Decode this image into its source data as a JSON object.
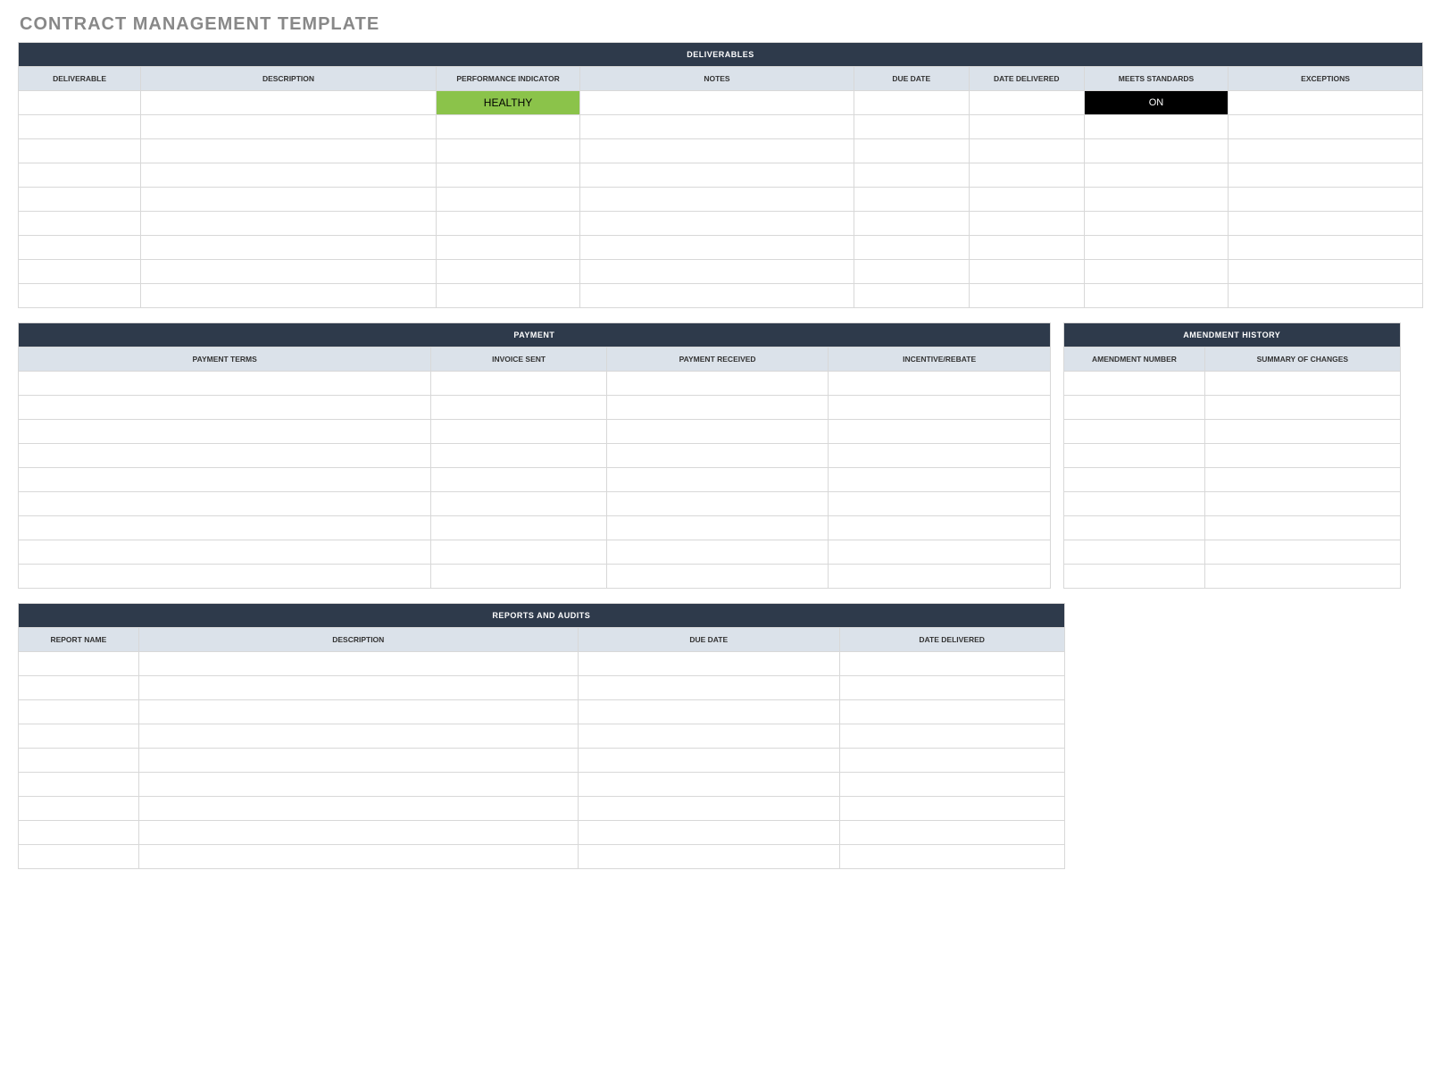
{
  "title": "CONTRACT MANAGEMENT TEMPLATE",
  "deliverables": {
    "section": "DELIVERABLES",
    "cols": [
      "DELIVERABLE",
      "DESCRIPTION",
      "PERFORMANCE INDICATOR",
      "NOTES",
      "DUE DATE",
      "DATE DELIVERED",
      "MEETS STANDARDS",
      "EXCEPTIONS"
    ],
    "row1_pi": "HEALTHY",
    "row1_ms": "ON",
    "rowCount": 9
  },
  "payment": {
    "section": "PAYMENT",
    "cols": [
      "PAYMENT TERMS",
      "INVOICE SENT",
      "PAYMENT RECEIVED",
      "INCENTIVE/REBATE"
    ],
    "rowCount": 9
  },
  "amendment": {
    "section": "AMENDMENT HISTORY",
    "cols": [
      "AMENDMENT NUMBER",
      "SUMMARY OF CHANGES"
    ],
    "rowCount": 9
  },
  "reports": {
    "section": "REPORTS AND AUDITS",
    "cols": [
      "REPORT NAME",
      "DESCRIPTION",
      "DUE DATE",
      "DATE DELIVERED"
    ],
    "rowCount": 9
  }
}
